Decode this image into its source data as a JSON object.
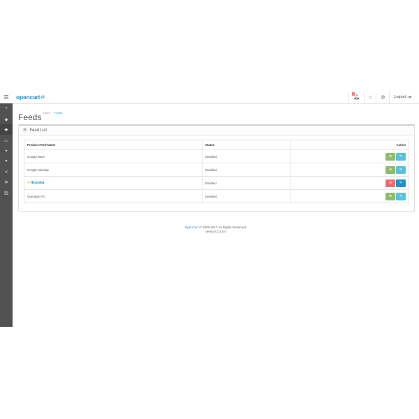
{
  "header": {
    "logo_text": "opencart",
    "logout_label": "Logout",
    "alert_count": "0"
  },
  "page": {
    "title": "Feeds",
    "breadcrumb": [
      "Home",
      "Feeds"
    ]
  },
  "panel": {
    "title": "Feed List"
  },
  "table": {
    "columns": [
      "Product Feed Name",
      "Status",
      "Action"
    ],
    "rows": [
      {
        "name": "Google Base",
        "status": "Disabled"
      },
      {
        "name": "Google Sitemap",
        "status": "Disabled"
      },
      {
        "name": "Heureka",
        "status": "Enabled"
      },
      {
        "name": "OpenBay Pro",
        "status": "Disabled"
      }
    ]
  },
  "footer": {
    "link": "OpenCart",
    "copyright": "© 2009-2017 All Rights Reserved.",
    "version": "Version 2.3.0.0"
  },
  "colors": {
    "accent": "#1e91cf",
    "success": "#8fbb6c",
    "danger": "#f56b6b",
    "sidebar": "#515151"
  }
}
